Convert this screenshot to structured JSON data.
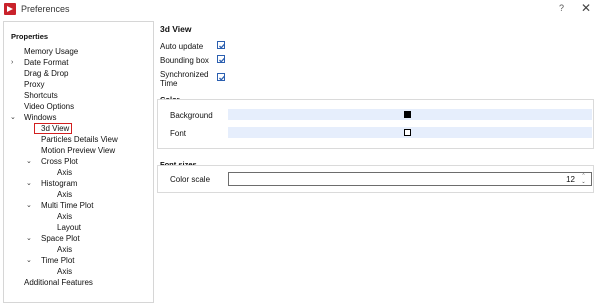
{
  "window": {
    "title": "Preferences",
    "help": "?",
    "close": "✕"
  },
  "left": {
    "header": "Properties",
    "items": [
      {
        "label": "Memory Usage"
      },
      {
        "label": "Date Format"
      },
      {
        "label": "Drag & Drop"
      },
      {
        "label": "Proxy"
      },
      {
        "label": "Shortcuts"
      },
      {
        "label": "Video Options"
      },
      {
        "label": "Windows"
      },
      {
        "label": "3d View"
      },
      {
        "label": "Particles Details View"
      },
      {
        "label": "Motion Preview View"
      },
      {
        "label": "Cross Plot"
      },
      {
        "label": "Axis"
      },
      {
        "label": "Histogram"
      },
      {
        "label": "Axis"
      },
      {
        "label": "Multi Time Plot"
      },
      {
        "label": "Axis"
      },
      {
        "label": "Layout"
      },
      {
        "label": "Space Plot"
      },
      {
        "label": "Axis"
      },
      {
        "label": "Time Plot"
      },
      {
        "label": "Axis"
      },
      {
        "label": "Additional Features"
      }
    ],
    "arrows": {
      "collapsed": "›",
      "expanded": "⌄"
    },
    "selected": "3d View"
  },
  "main": {
    "title": "3d View",
    "checks": [
      {
        "label": "Auto update",
        "checked": true
      },
      {
        "label": "Bounding box",
        "checked": true
      },
      {
        "label": "Synchronized",
        "label2": "Time",
        "checked": true
      }
    ],
    "color": {
      "title": "Color",
      "rows": [
        {
          "label": "Background",
          "swatch": "#000000"
        },
        {
          "label": "Font",
          "swatch": "#ffffff"
        }
      ]
    },
    "font_sizes": {
      "title": "Font sizes",
      "label": "Color scale",
      "value": "12",
      "up": "⌃",
      "down": "⌄"
    }
  }
}
